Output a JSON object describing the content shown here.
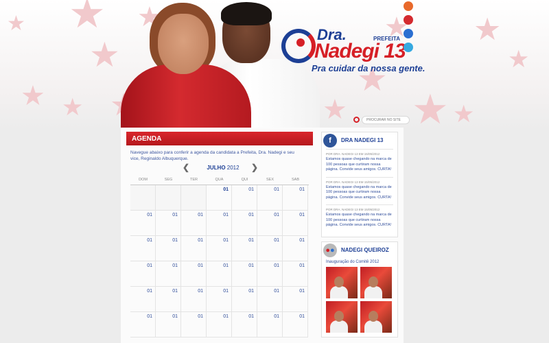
{
  "header": {
    "logo": {
      "dra": "Dra.",
      "prefeita": "PREFEITA",
      "name": "Nadegi",
      "number": "13"
    },
    "slogan": "Pra cuidar da nossa gente.",
    "social": [
      {
        "name": "rss-icon",
        "color": "#e8692b",
        "glyph": ""
      },
      {
        "name": "youtube-icon",
        "color": "#d42a2f",
        "glyph": ""
      },
      {
        "name": "flickr-icon",
        "color": "#2b6fd1",
        "glyph": ""
      },
      {
        "name": "twitter-icon",
        "color": "#36a9e0",
        "glyph": ""
      }
    ],
    "search": {
      "placeholder": "PROCURAR NO SITE"
    }
  },
  "agenda": {
    "title": "AGENDA",
    "intro": "Navegue abaixo para conferir a agenda da candidata a Prefeita, Dra. Nadegi e seu vice, Reginaldo Albuquerque.",
    "month": "JULHO",
    "year": "2012",
    "prev": "❮",
    "next": "❯",
    "weekdays": [
      "DOM",
      "SEG",
      "TER",
      "QUA",
      "QUI",
      "SEX",
      "SAB"
    ],
    "leading_empty": 3,
    "day_label": "01",
    "rows": 6
  },
  "facebook": {
    "title": "DRA NADEGI 13",
    "posts": [
      {
        "meta": "POR DRA. NADEGI 13 EM 15/05/2012",
        "text": "Estamos quase chegando na marca de 100 pessoas que curtiram nossa página. Convide seus amigos. CURTA!"
      },
      {
        "meta": "POR DRA. NADEGI 13 EM 15/05/2012",
        "text": "Estamos quase chegando na marca de 100 pessoas que curtiram nossa página. Convide seus amigos. CURTA!"
      },
      {
        "meta": "POR DRA. NADEGI 13 EM 15/05/2012",
        "text": "Estamos quase chegando na marca de 100 pessoas que curtiram nossa página. Convide seus amigos. CURTA!"
      }
    ]
  },
  "flickr": {
    "title": "NADEGI QUEIROZ",
    "album": "Inauguração do Comitê 2012",
    "thumbs": [
      "nadegi",
      "nadegi",
      "nadegi",
      "nadegi"
    ]
  }
}
